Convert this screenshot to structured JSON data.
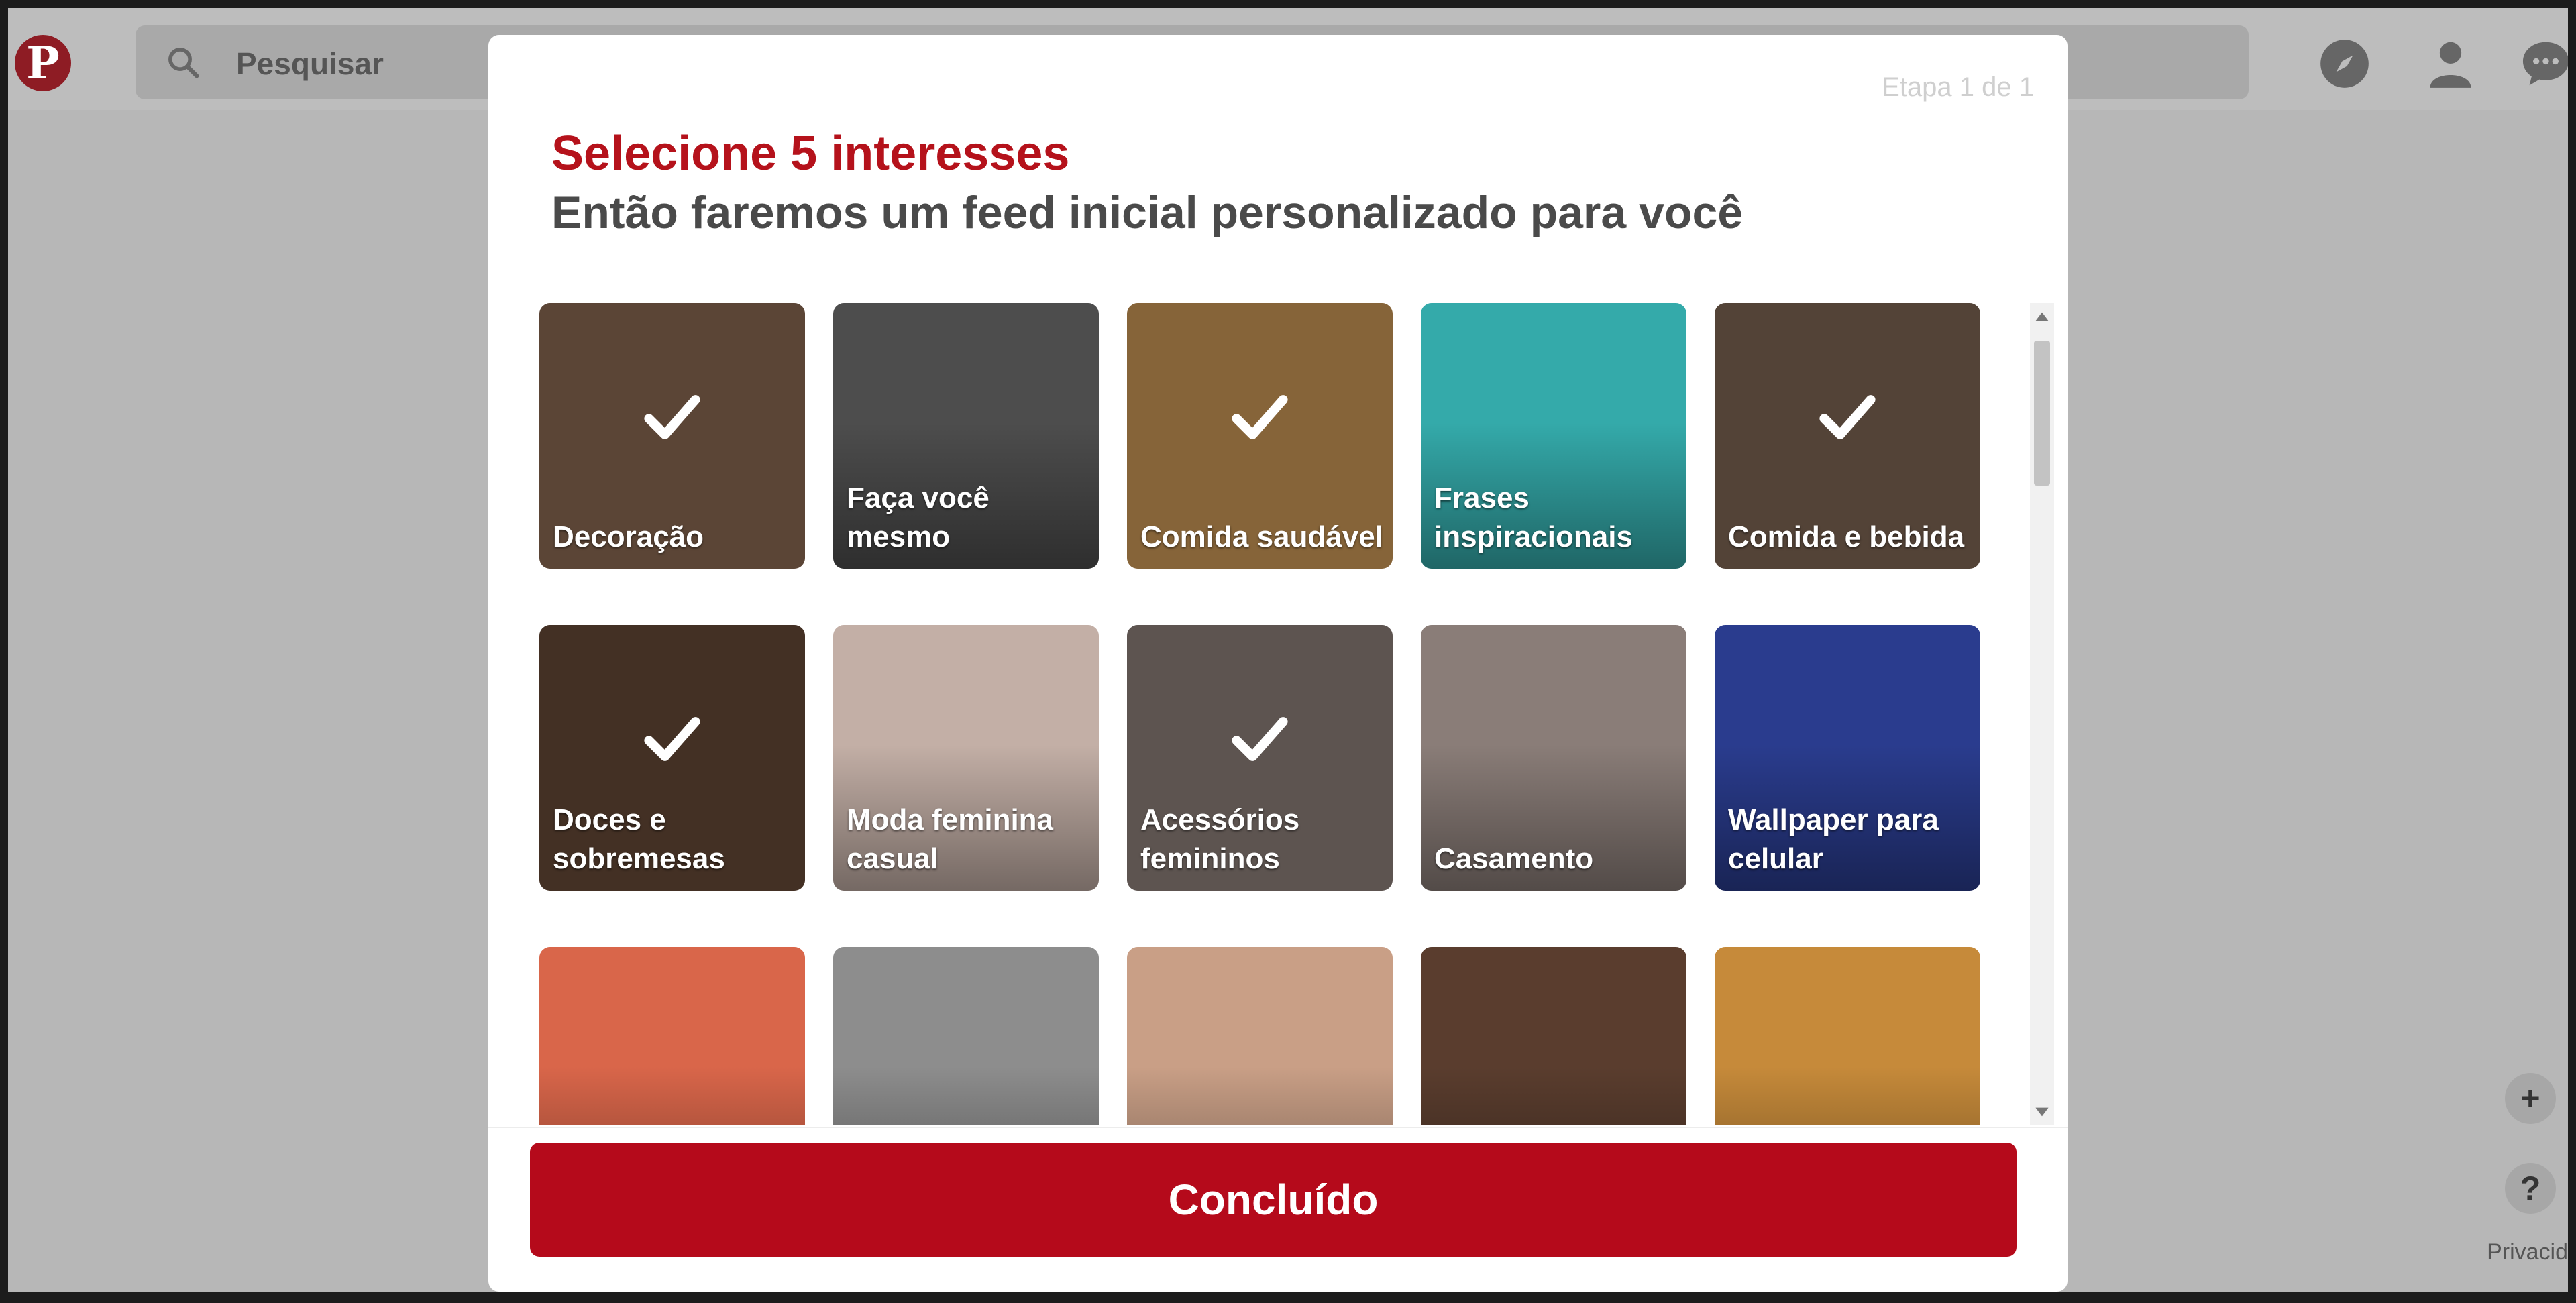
{
  "header": {
    "search_placeholder": "Pesquisar"
  },
  "modal": {
    "step": "Etapa 1 de 1",
    "title": "Selecione 5 interesses",
    "subtitle": "Então faremos um feed inicial personalizado para você",
    "done_label": "Concluído"
  },
  "interests": [
    {
      "label": "Decoração",
      "selected": true,
      "color": "#7a5c48"
    },
    {
      "label": "Faça você mesmo",
      "selected": false,
      "color": "#4d4d4d"
    },
    {
      "label": "Comida saudável",
      "selected": true,
      "color": "#b3864c"
    },
    {
      "label": "Frases inspiracionais",
      "selected": false,
      "color": "#34aaaa"
    },
    {
      "label": "Comida e bebida",
      "selected": true,
      "color": "#6f5a4a"
    },
    {
      "label": "Doces e sobremesas",
      "selected": true,
      "color": "#5a4030"
    },
    {
      "label": "Moda feminina casual",
      "selected": false,
      "color": "#c3afa6"
    },
    {
      "label": "Acessórios femininos",
      "selected": true,
      "color": "#7c706b"
    },
    {
      "label": "Casamento",
      "selected": false,
      "color": "#8a7d78"
    },
    {
      "label": "Wallpaper para celular",
      "selected": false,
      "color": "#2a3c8e"
    },
    {
      "label": "",
      "selected": false,
      "color": "#d9664a"
    },
    {
      "label": "",
      "selected": false,
      "color": "#8d8d8d"
    },
    {
      "label": "",
      "selected": false,
      "color": "#c99f86"
    },
    {
      "label": "",
      "selected": false,
      "color": "#5a3d2e"
    },
    {
      "label": "",
      "selected": false,
      "color": "#c68a3a"
    }
  ],
  "colors": {
    "accent": "#b50a1b",
    "title": "#b5121b"
  },
  "icons": {
    "logo": "pinterest-logo",
    "search": "search-icon",
    "explore": "compass-icon",
    "profile": "user-icon",
    "messages": "chat-icon",
    "add": "plus-icon",
    "help": "help-icon",
    "check": "check-icon"
  }
}
